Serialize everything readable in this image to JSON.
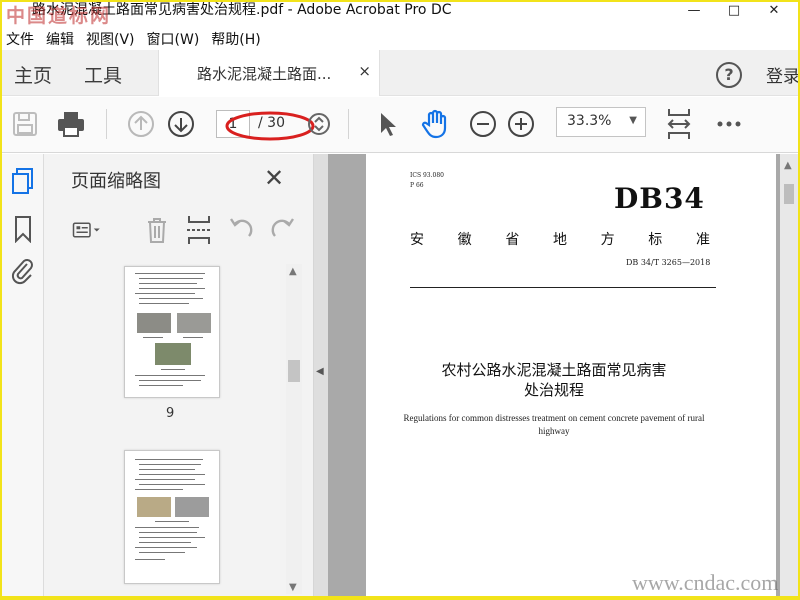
{
  "window": {
    "title": "路水泥混凝土路面常见病害处治规程.pdf - Adobe Acrobat Pro DC",
    "watermark": "中国道标网",
    "controls": [
      "—",
      "□",
      "✕"
    ]
  },
  "menu": [
    "文件",
    "编辑",
    "视图(V)",
    "窗口(W)",
    "帮助(H)"
  ],
  "tabs": {
    "home": "主页",
    "tools": "工具",
    "document": "路水泥混凝土路面...",
    "close": "×",
    "help": "?",
    "signin": "登录"
  },
  "toolbar": {
    "page_current": "1",
    "page_total": "/ 30",
    "zoom": "33.3%",
    "icons": [
      "save-icon",
      "print-icon",
      "page-up-icon",
      "page-down-icon",
      "page-stepper-icon",
      "select-arrow-icon",
      "hand-icon",
      "zoom-out-icon",
      "zoom-in-icon",
      "fit-page-icon",
      "more-icon"
    ],
    "annotation_color": "#d9201f"
  },
  "rail": {
    "icons": [
      "page-thumbnails-icon",
      "bookmark-icon",
      "attachment-icon"
    ]
  },
  "thumbnails_panel": {
    "title": "页面缩略图",
    "close": "✕",
    "page_numbers": [
      "9"
    ]
  },
  "document_page": {
    "ics": "ICS 93.080",
    "pcode": "P 66",
    "code": "DB34",
    "province": [
      "安",
      "徽",
      "省",
      "地",
      "方",
      "标",
      "准"
    ],
    "standard_number": "DB 34/T 3265—2018",
    "title_cn_line1": "农村公路水泥混凝土路面常见病害",
    "title_cn_line2": "处治规程",
    "title_en": "Regulations for common distresses treatment on cement concrete pavement of rural highway"
  },
  "site_watermark": "www.cndac.com"
}
